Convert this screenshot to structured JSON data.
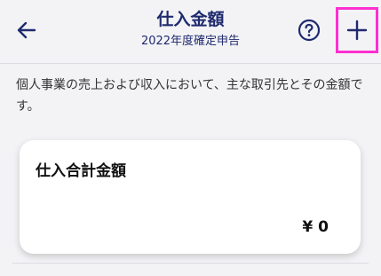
{
  "header": {
    "title": "仕入金額",
    "subtitle": "2022年度確定申告"
  },
  "icons": {
    "back": "arrow-left-icon",
    "help": "question-circle-icon",
    "add": "plus-icon"
  },
  "colors": {
    "accent": "#1f2a6e",
    "highlight": "#ff2fd0",
    "background": "#f3f3f6",
    "card": "#ffffff"
  },
  "description": "個人事業の売上および収入において、主な取引先とその金額です。",
  "summary_card": {
    "label": "仕入合計金額",
    "amount": "¥ 0"
  }
}
